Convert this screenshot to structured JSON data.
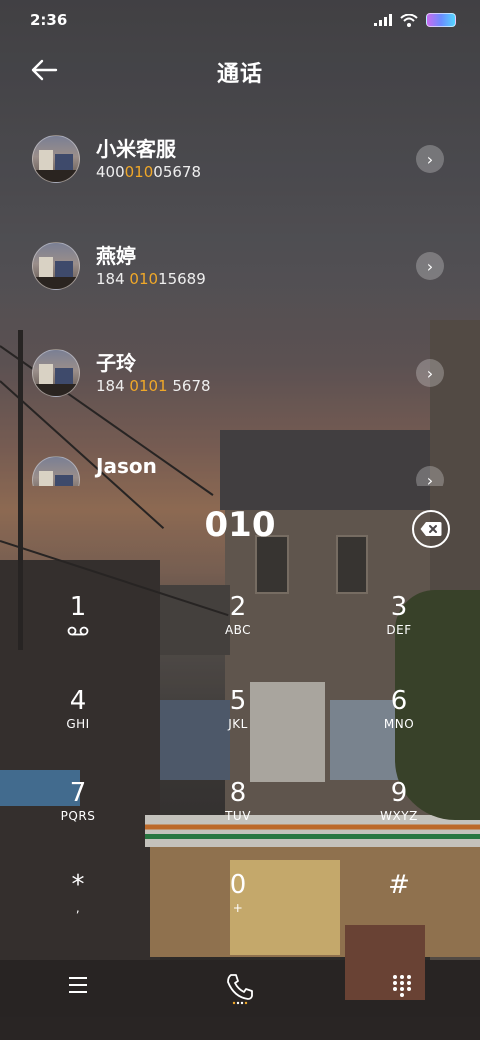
{
  "status": {
    "time": "2:36"
  },
  "header": {
    "title": "通话"
  },
  "contacts": [
    {
      "name": "小米客服",
      "num_pre": "400",
      "num_hl": "010",
      "num_post": "05678"
    },
    {
      "name": "燕婷",
      "num_pre": "184 ",
      "num_hl": "010",
      "num_post": "15689"
    },
    {
      "name": "子玲",
      "num_pre": "184 ",
      "num_hl": "0101",
      "num_post": " 5678"
    },
    {
      "name": "Jason",
      "num_pre": "",
      "num_hl": "",
      "num_post": ""
    }
  ],
  "dialed": "010",
  "keypad": [
    {
      "digit": "1",
      "letters": ""
    },
    {
      "digit": "2",
      "letters": "ABC"
    },
    {
      "digit": "3",
      "letters": "DEF"
    },
    {
      "digit": "4",
      "letters": "GHI"
    },
    {
      "digit": "5",
      "letters": "JKL"
    },
    {
      "digit": "6",
      "letters": "MNO"
    },
    {
      "digit": "7",
      "letters": "PQRS"
    },
    {
      "digit": "8",
      "letters": "TUV"
    },
    {
      "digit": "9",
      "letters": "WXYZ"
    },
    {
      "digit": "*",
      "letters": ","
    },
    {
      "digit": "0",
      "letters": "+"
    },
    {
      "digit": "#",
      "letters": ""
    }
  ],
  "colors": {
    "highlight": "#f0a829"
  }
}
